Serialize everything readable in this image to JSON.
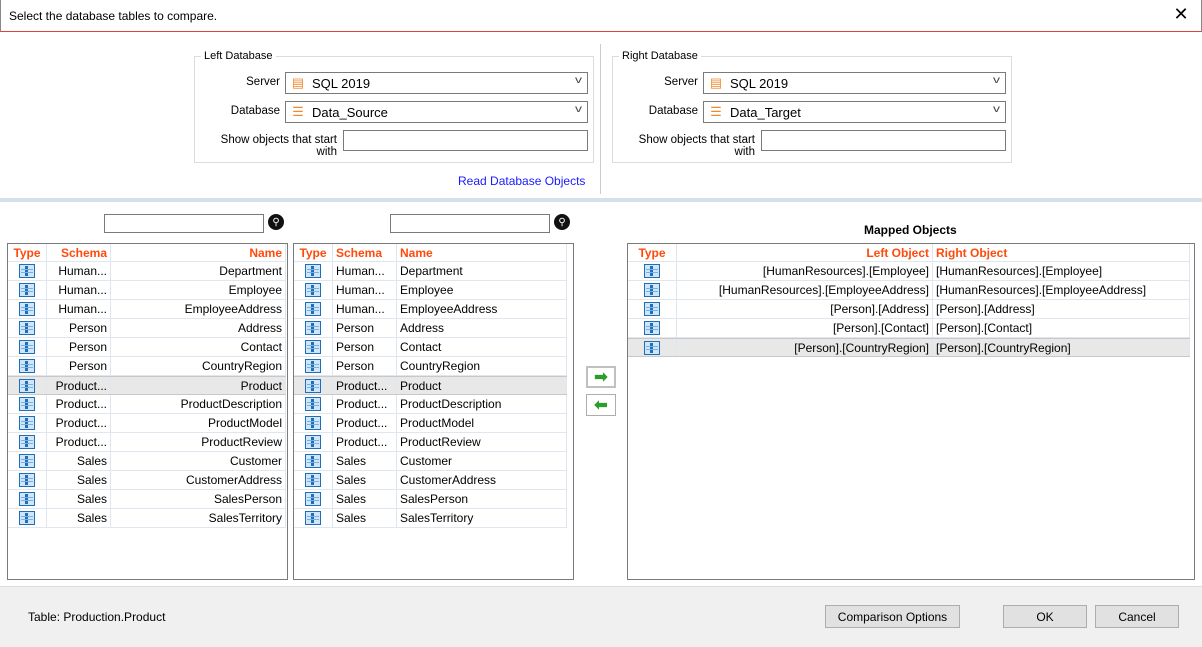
{
  "title": "Select the database tables to compare.",
  "left_db": {
    "legend": "Left Database",
    "server_label": "Server",
    "server": "SQL 2019",
    "database_label": "Database",
    "database": "Data_Source",
    "filter_label": "Show objects that start with",
    "filter": ""
  },
  "right_db": {
    "legend": "Right Database",
    "server_label": "Server",
    "server": "SQL 2019",
    "database_label": "Database",
    "database": "Data_Target",
    "filter_label": "Show objects that start with",
    "filter": ""
  },
  "read_link": "Read Database Objects",
  "columns": {
    "type": "Type",
    "schema": "Schema",
    "name": "Name",
    "left_object": "Left Object",
    "right_object": "Right Object"
  },
  "left_rows": [
    [
      "Human...",
      "Department"
    ],
    [
      "Human...",
      "Employee"
    ],
    [
      "Human...",
      "EmployeeAddress"
    ],
    [
      "Person",
      "Address"
    ],
    [
      "Person",
      "Contact"
    ],
    [
      "Person",
      "CountryRegion"
    ],
    [
      "Product...",
      "Product"
    ],
    [
      "Product...",
      "ProductDescription"
    ],
    [
      "Product...",
      "ProductModel"
    ],
    [
      "Product...",
      "ProductReview"
    ],
    [
      "Sales",
      "Customer"
    ],
    [
      "Sales",
      "CustomerAddress"
    ],
    [
      "Sales",
      "SalesPerson"
    ],
    [
      "Sales",
      "SalesTerritory"
    ]
  ],
  "right_rows": [
    [
      "Human...",
      "Department"
    ],
    [
      "Human...",
      "Employee"
    ],
    [
      "Human...",
      "EmployeeAddress"
    ],
    [
      "Person",
      "Address"
    ],
    [
      "Person",
      "Contact"
    ],
    [
      "Person",
      "CountryRegion"
    ],
    [
      "Product...",
      "Product"
    ],
    [
      "Product...",
      "ProductDescription"
    ],
    [
      "Product...",
      "ProductModel"
    ],
    [
      "Product...",
      "ProductReview"
    ],
    [
      "Sales",
      "Customer"
    ],
    [
      "Sales",
      "CustomerAddress"
    ],
    [
      "Sales",
      "SalesPerson"
    ],
    [
      "Sales",
      "SalesTerritory"
    ]
  ],
  "selected_row": 6,
  "mapped_title": "Mapped Objects",
  "mapped_rows": [
    [
      "[HumanResources].[Employee]",
      "[HumanResources].[Employee]"
    ],
    [
      "[HumanResources].[EmployeeAddress]",
      "[HumanResources].[EmployeeAddress]"
    ],
    [
      "[Person].[Address]",
      "[Person].[Address]"
    ],
    [
      "[Person].[Contact]",
      "[Person].[Contact]"
    ],
    [
      "[Person].[CountryRegion]",
      "[Person].[CountryRegion]"
    ]
  ],
  "mapped_selected": 4,
  "status": "Table: Production.Product",
  "buttons": {
    "options": "Comparison Options",
    "ok": "OK",
    "cancel": "Cancel",
    "map_right": "➡",
    "map_left": "⬅"
  }
}
